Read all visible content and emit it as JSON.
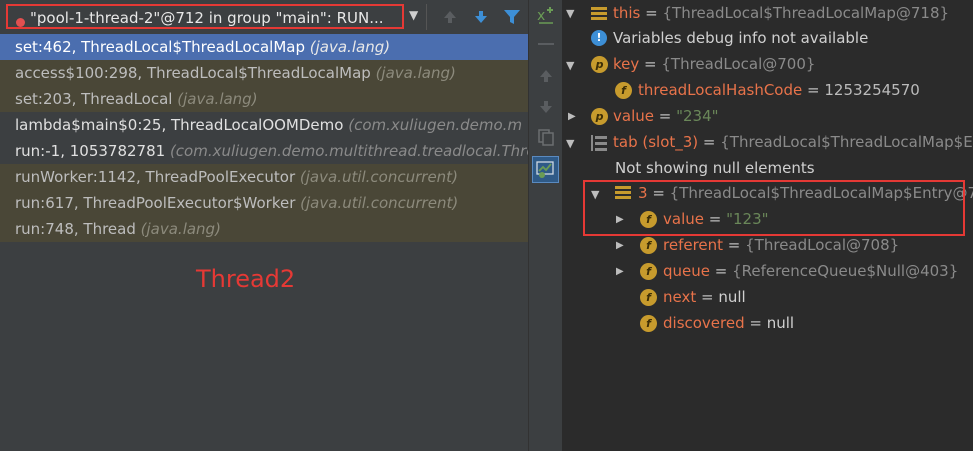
{
  "thread_selector": {
    "value": "\"pool-1-thread-2\"@712 in group \"main\": RUN..."
  },
  "frames": [
    {
      "method": "set:462, ThreadLocal$ThreadLocalMap",
      "pkg": "(java.lang)",
      "style": "sel"
    },
    {
      "method": "access$100:298, ThreadLocal$ThreadLocalMap",
      "pkg": "(java.lang)",
      "style": "lib"
    },
    {
      "method": "set:203, ThreadLocal",
      "pkg": "(java.lang)",
      "style": "lib"
    },
    {
      "method": "lambda$main$0:25, ThreadLocalOOMDemo",
      "pkg": "(com.xuliugen.demo.m",
      "style": "norm"
    },
    {
      "method": "run:-1, 1053782781",
      "pkg": "(com.xuliugen.demo.multithread.treadlocal.Thre",
      "style": "norm"
    },
    {
      "method": "runWorker:1142, ThreadPoolExecutor",
      "pkg": "(java.util.concurrent)",
      "style": "lib"
    },
    {
      "method": "run:617, ThreadPoolExecutor$Worker",
      "pkg": "(java.util.concurrent)",
      "style": "lib"
    },
    {
      "method": "run:748, Thread",
      "pkg": "(java.lang)",
      "style": "lib"
    }
  ],
  "annotation": "Thread2",
  "variables": {
    "this": {
      "name": "this",
      "eq": " = ",
      "value": "{ThreadLocal$ThreadLocalMap@718}"
    },
    "info": "Variables debug info not available",
    "key": {
      "name": "key",
      "eq": " = ",
      "value": "{ThreadLocal@700}"
    },
    "hash": {
      "name": "threadLocalHashCode",
      "eq": " = ",
      "value": "1253254570"
    },
    "value": {
      "name": "value",
      "eq": " = ",
      "value": "\"234\""
    },
    "tab": {
      "name": "tab (slot_3)",
      "eq": " = ",
      "value": "{ThreadLocal$ThreadLocalMap$En"
    },
    "nulls": "Not showing null elements",
    "entry": {
      "name": "3",
      "eq": " = ",
      "value": "{ThreadLocal$ThreadLocalMap$Entry@7"
    },
    "entry_value": {
      "name": "value",
      "eq": " = ",
      "value": "\"123\""
    },
    "referent": {
      "name": "referent",
      "eq": " = ",
      "value": "{ThreadLocal@708}"
    },
    "queue": {
      "name": "queue",
      "eq": " = ",
      "value": "{ReferenceQueue$Null@403}"
    },
    "next": {
      "name": "next",
      "eq": " = ",
      "value": "null"
    },
    "discovered": {
      "name": "discovered",
      "eq": " = ",
      "value": "null"
    }
  },
  "colors": {
    "highlight": "#e53935",
    "selection": "#4b6eaf",
    "library_frame": "#4a4737",
    "field_badge": "#c79b2d"
  }
}
